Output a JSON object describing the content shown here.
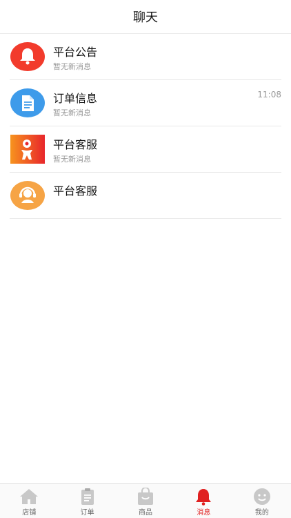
{
  "header": {
    "title": "聊天"
  },
  "conversations": [
    {
      "name": "平台公告",
      "preview": "暂无新消息",
      "time": "",
      "icon": "bell-icon"
    },
    {
      "name": "订单信息",
      "preview": "暂无新消息",
      "time": "11:08",
      "icon": "document-icon"
    },
    {
      "name": "平台客服",
      "preview": "暂无新消息",
      "time": "",
      "icon": "brand-logo"
    },
    {
      "name": "平台客服",
      "preview": "",
      "time": "",
      "icon": "headset-support-icon"
    }
  ],
  "tabbar": {
    "active": "消息",
    "items": [
      {
        "label": "店铺",
        "icon": "shop-icon"
      },
      {
        "label": "订单",
        "icon": "order-clipboard-icon"
      },
      {
        "label": "商品",
        "icon": "shopping-bag-icon"
      },
      {
        "label": "消息",
        "icon": "bell-icon"
      },
      {
        "label": "我的",
        "icon": "smiley-profile-icon"
      }
    ]
  },
  "colors": {
    "accent": "#e02020",
    "inactive": "#c8c8c8",
    "bell_avatar": "#f23b2c",
    "doc_avatar": "#3e9bea",
    "support_avatar": "#f6a445"
  }
}
